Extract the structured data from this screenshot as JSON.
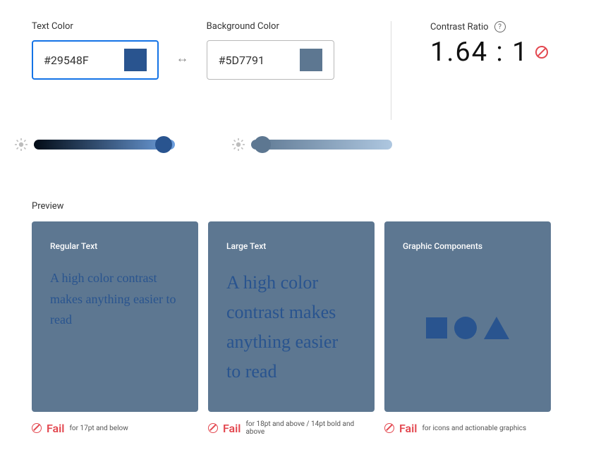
{
  "textColor": {
    "label": "Text Color",
    "value": "#29548F",
    "hex": "#29548F",
    "slider": {
      "gradientStart": "#020b16",
      "gradientEnd": "#6ea0df",
      "thumbColor": "#29548F",
      "thumbPos": 92
    }
  },
  "bgColor": {
    "label": "Background Color",
    "value": "#5D7791",
    "hex": "#5D7791",
    "slider": {
      "gradientStart": "#5d7791",
      "gradientEnd": "#aec7e0",
      "thumbColor": "#5D7791",
      "thumbPos": 8
    }
  },
  "swapIcon": "↔",
  "contrast": {
    "label": "Contrast Ratio",
    "value": "1.64 : 1",
    "status": "fail"
  },
  "preview": {
    "label": "Preview",
    "sample": "A high color contrast makes anything easier to read",
    "cards": {
      "regular": {
        "title": "Regular Text"
      },
      "large": {
        "title": "Large Text"
      },
      "graphic": {
        "title": "Graphic Components"
      }
    }
  },
  "results": {
    "regular": {
      "status": "Fail",
      "desc": "for 17pt and below"
    },
    "large": {
      "status": "Fail",
      "desc": "for 18pt and above / 14pt bold and above"
    },
    "graphic": {
      "status": "Fail",
      "desc": "for icons and actionable graphics"
    }
  }
}
